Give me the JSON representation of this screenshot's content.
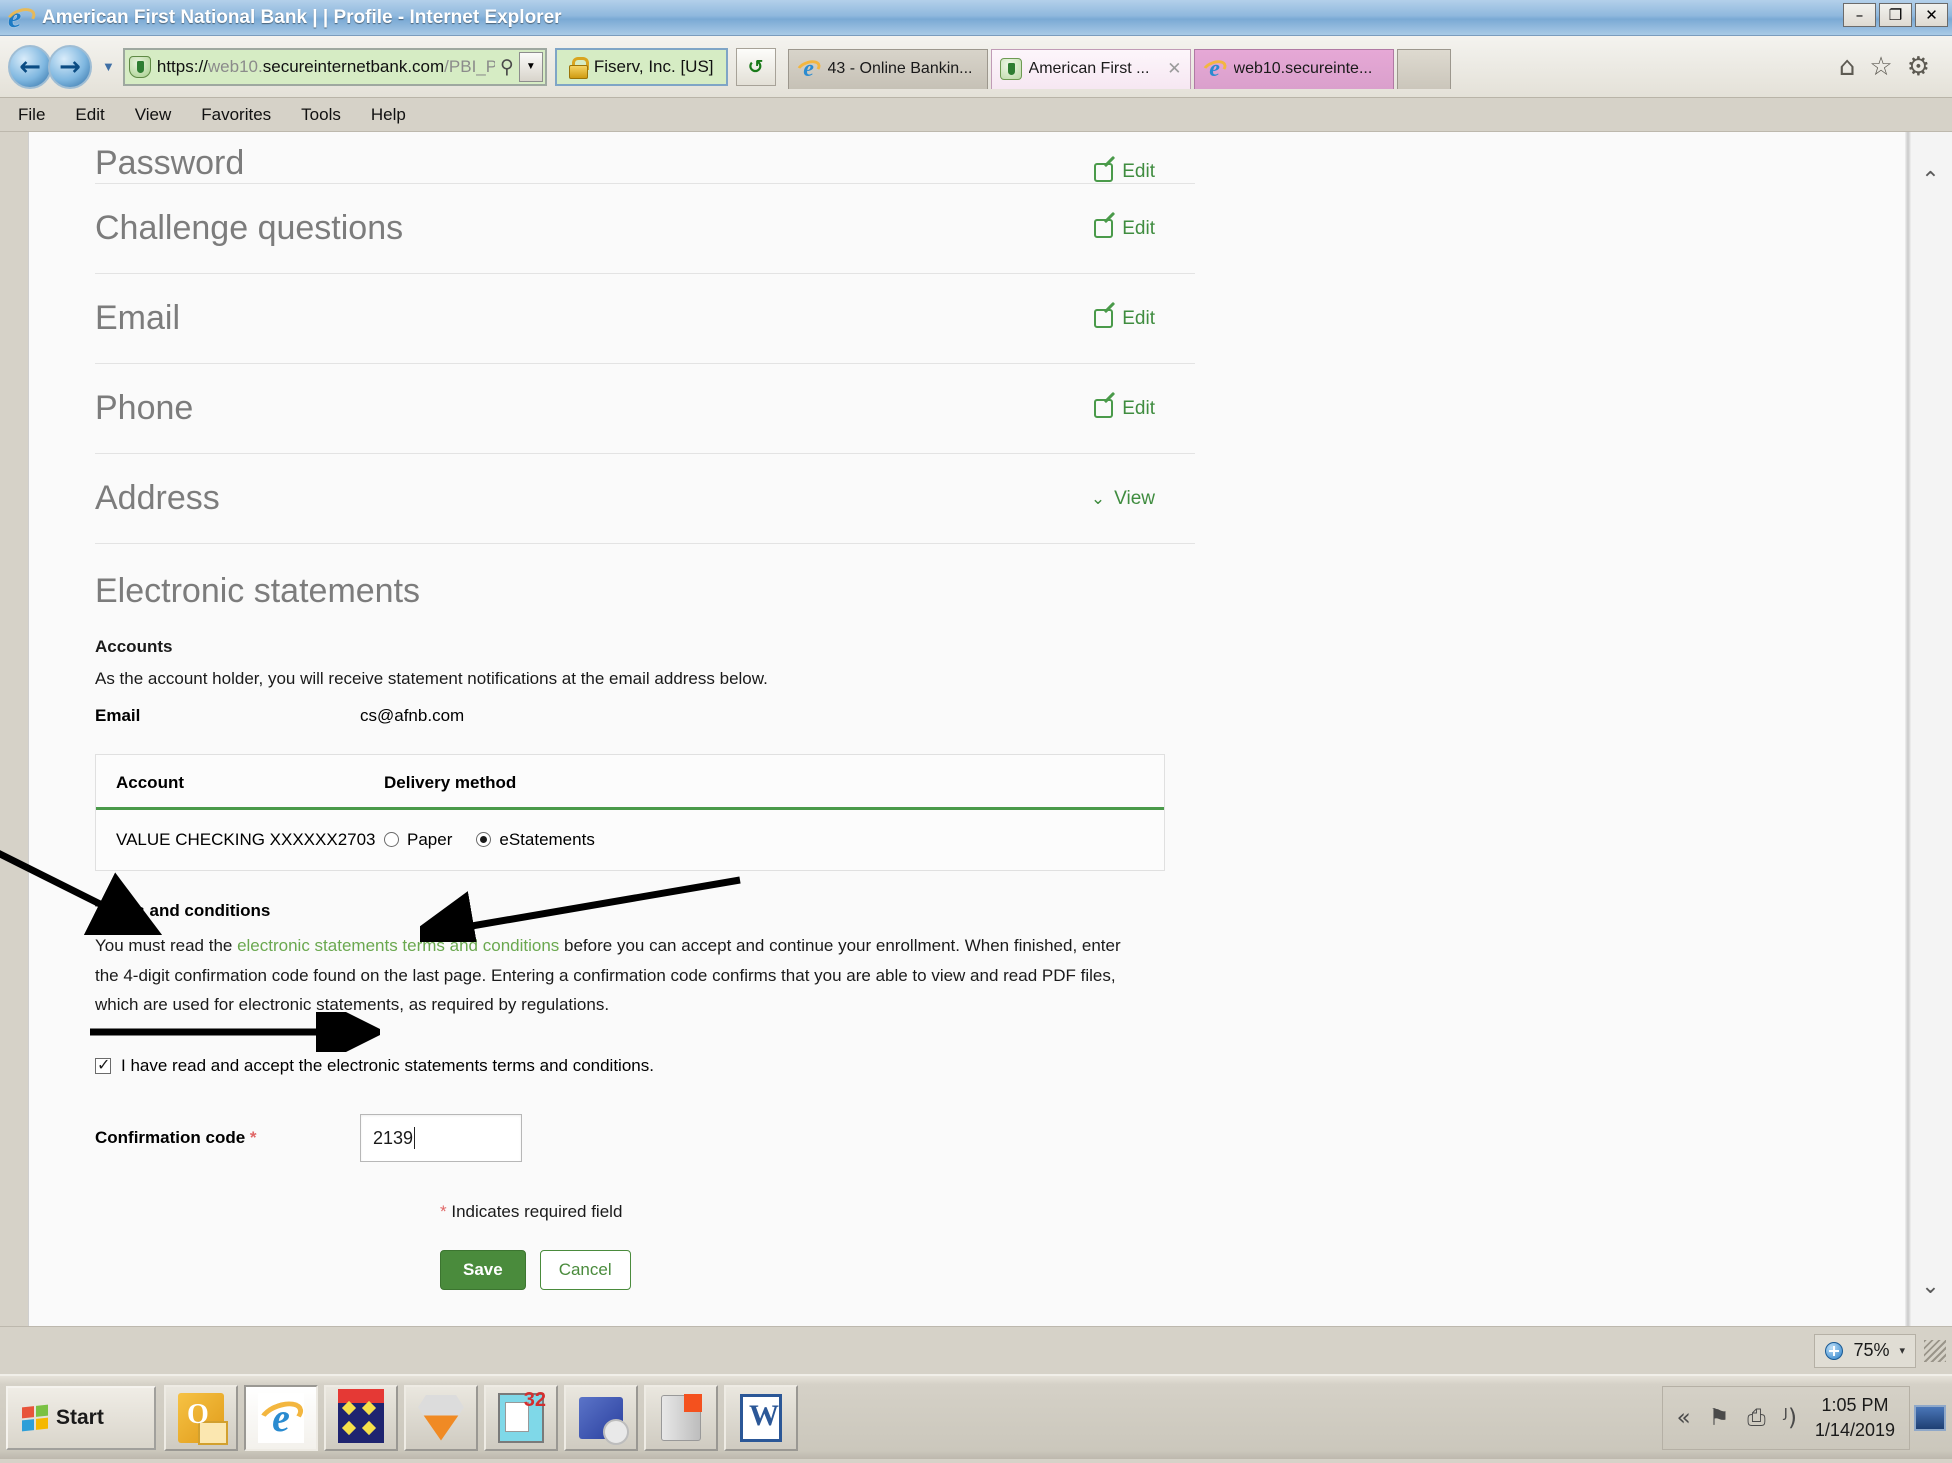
{
  "window": {
    "title": "American First National Bank |  | Profile - Internet Explorer",
    "minimize": "–",
    "restore": "❐",
    "close": "✕"
  },
  "nav": {
    "back_icon": "←",
    "forward_icon": "→",
    "history_caret": "▼",
    "url_scheme": "https://",
    "url_host_dim": "web10.",
    "url_host": "secureinternetbank.com",
    "url_path": "/PBI_PB",
    "search_icon": "⚲",
    "dropdown_caret": "▼",
    "ssl_label": "Fiserv, Inc.  [US]",
    "refresh_icon": "↺",
    "home_icon": "⌂",
    "favorites_icon": "☆",
    "tools_icon": "⚙"
  },
  "tabs": [
    {
      "label": "43 - Online Bankin...",
      "icon": "ie-icon",
      "state": "inactive",
      "closable": false
    },
    {
      "label": "American First ...",
      "icon": "shield-icon",
      "state": "active",
      "closable": true,
      "close_glyph": "✕"
    },
    {
      "label": "web10.secureinte...",
      "icon": "ie-icon",
      "state": "pink",
      "closable": false
    }
  ],
  "menu": [
    "File",
    "Edit",
    "View",
    "Favorites",
    "Tools",
    "Help"
  ],
  "profile_rows": [
    {
      "title": "Password",
      "action": "Edit",
      "action_icon": "edit-pencil-icon"
    },
    {
      "title": "Challenge questions",
      "action": "Edit",
      "action_icon": "edit-pencil-icon"
    },
    {
      "title": "Email",
      "action": "Edit",
      "action_icon": "edit-pencil-icon"
    },
    {
      "title": "Phone",
      "action": "Edit",
      "action_icon": "edit-pencil-icon"
    },
    {
      "title": "Address",
      "action": "View",
      "action_icon": "chevron-down-icon"
    }
  ],
  "estatements": {
    "section_title": "Electronic statements",
    "accounts_label": "Accounts",
    "accounts_note": "As the account holder, you will receive statement notifications at the email address below.",
    "email_label": "Email",
    "email_value": "cs@afnb.com",
    "table": {
      "headers": [
        "Account",
        "Delivery method"
      ],
      "rows": [
        {
          "account": "VALUE CHECKING XXXXXX2703",
          "options": [
            {
              "label": "Paper",
              "selected": false
            },
            {
              "label": "eStatements",
              "selected": true
            }
          ]
        }
      ]
    },
    "terms_heading": "Terms and conditions",
    "terms_part1": "You must read the ",
    "terms_link": "electronic statements terms and conditions",
    "terms_part2": " before you can accept and continue your enrollment. When finished, enter the 4-digit confirmation code found on the last page. Entering a confirmation code confirms that you are able to view and read PDF files, which are used for electronic statements, as required by regulations.",
    "accept_label": "I have read and accept the electronic statements terms and conditions.",
    "accept_checked": true,
    "code_label": "Confirmation code",
    "code_required_mark": "*",
    "code_value": "2139",
    "required_note_mark": "*",
    "required_note": " Indicates required field",
    "save_label": "Save",
    "cancel_label": "Cancel"
  },
  "scroll": {
    "up_icon": "⌃",
    "down_icon": "⌄"
  },
  "status": {
    "zoom_icon": "zoom-in-icon",
    "zoom_value": "75%",
    "zoom_caret": "▾"
  },
  "taskbar": {
    "start_label": "Start",
    "items": [
      {
        "name": "outlook",
        "selected": false
      },
      {
        "name": "internet-explorer",
        "selected": true
      },
      {
        "name": "diamonds-app",
        "selected": false
      },
      {
        "name": "gem-app",
        "selected": false
      },
      {
        "name": "check-printing-app",
        "selected": false
      },
      {
        "name": "remote-desktop-app",
        "selected": false
      },
      {
        "name": "jar-app",
        "selected": false
      },
      {
        "name": "word",
        "selected": false
      }
    ],
    "tray": {
      "show_hidden_icon": "«",
      "flag_icon": "⚑",
      "network_icon": "⎙",
      "volume_icon": "ᴶ)",
      "time": "1:05 PM",
      "date": "1/14/2019"
    }
  },
  "colors": {
    "brand_green": "#4a8b3c",
    "link_green": "#6aa84f",
    "required_red": "#e06666",
    "heading_gray": "#7c7c7c"
  }
}
